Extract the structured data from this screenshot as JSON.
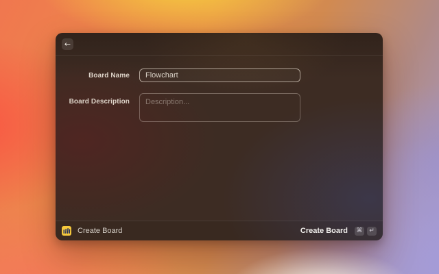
{
  "dialog": {
    "header": {
      "back_icon": "←"
    },
    "form": {
      "name": {
        "label": "Board Name",
        "value": "Flowchart"
      },
      "description": {
        "label": "Board Description",
        "placeholder": "Description..."
      }
    },
    "footer": {
      "app_title": "Create Board",
      "action_label": "Create Board",
      "keys": [
        "⌘",
        "↵"
      ]
    }
  },
  "colors": {
    "logo_bg": "#f7c93c",
    "logo_glyph": "#1d2b5e"
  }
}
